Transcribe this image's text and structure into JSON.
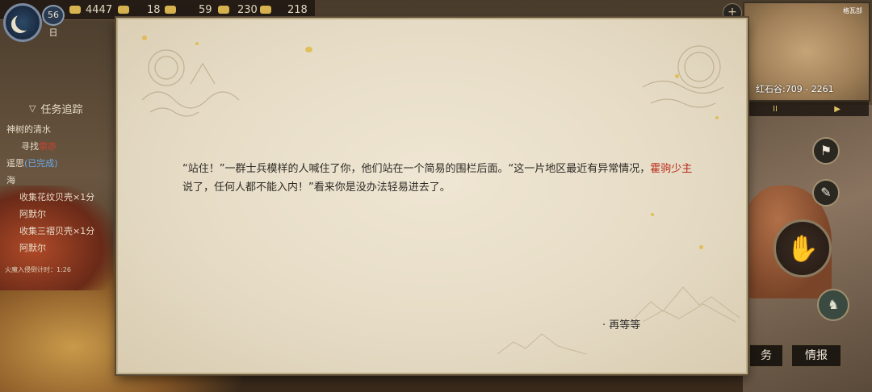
{
  "hud": {
    "day": "56日",
    "resources": [
      {
        "icon": "silver-coin-icon",
        "value": "4447"
      },
      {
        "icon": "gold-ingot-icon",
        "value": "18"
      },
      {
        "icon": "copper-coin-icon",
        "value": "59"
      },
      {
        "icon": "grain-sack-icon",
        "value": "230"
      },
      {
        "icon": "feather-token-icon",
        "value": "218"
      }
    ]
  },
  "quest_tracker": {
    "title": "任务追踪",
    "q1_title": "神树的清水",
    "q1_step_prefix": "寻找",
    "q1_step_target": "崇亦",
    "q2_title": "遥思",
    "q2_status": "(已完成)",
    "q3_title": "海",
    "q3_step1": "收集花纹贝壳×1分",
    "q3_step1_npc": "阿默尔",
    "q3_step2": "收集三褶贝壳×1分",
    "q3_step2_npc": "阿默尔",
    "timer": "火魔入侵倒计时：1:26"
  },
  "minimap": {
    "location": "红石谷",
    "coords": "709 - 2261",
    "label_top": "格瓦部",
    "pause": "II",
    "play": "▶"
  },
  "dialog": {
    "text_before": "“站住！”一群士兵模样的人喊住了你，他们站在一个简易的围栏后面。“这一片地区最近有异常情况，",
    "highlight": "霍驹少主",
    "text_after": "说了，任何人都不能入内！”看来你是没办法轻易进去了。",
    "choice": "· 再等等"
  },
  "buttons": {
    "tab_tasks": "务",
    "tab_intel": "情报"
  },
  "colors": {
    "highlight_red": "#b82818",
    "paper": "#e8dfca"
  }
}
